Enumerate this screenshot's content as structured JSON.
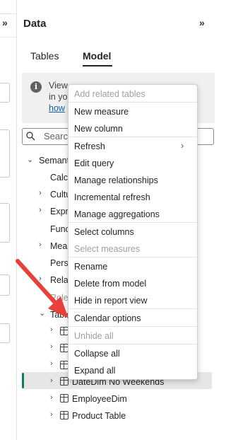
{
  "pane": {
    "title": "Data",
    "collapse_glyph": "»",
    "left_expand_glyph": "»",
    "tabs": [
      {
        "label": "Tables",
        "active": false
      },
      {
        "label": "Model",
        "active": true
      }
    ]
  },
  "info": {
    "line1": "View",
    "line2": "in yo",
    "link": "how"
  },
  "search": {
    "placeholder": "Searc"
  },
  "tree": {
    "semantic_model": "Semant",
    "items": [
      {
        "label": "Calcu",
        "chevron": false
      },
      {
        "label": "Cultu",
        "chevron": true
      },
      {
        "label": "Expre",
        "chevron": true
      },
      {
        "label": "Func",
        "chevron": false
      },
      {
        "label": "Meas",
        "chevron": true
      },
      {
        "label": "Persp",
        "chevron": false
      },
      {
        "label": "Relat",
        "chevron": true
      },
      {
        "label": "Role",
        "chevron": false
      }
    ],
    "tables_label": "Table",
    "tables": [
      {
        "label": ""
      },
      {
        "label": ""
      },
      {
        "label": ""
      },
      {
        "label": "DateDim No Weekends",
        "selected": true
      },
      {
        "label": "EmployeeDim"
      },
      {
        "label": "Product Table"
      }
    ]
  },
  "context_menu": {
    "items": [
      {
        "label": "Add related tables",
        "disabled": true
      },
      {
        "label": "New measure",
        "disabled": false
      },
      {
        "label": "New column",
        "disabled": false
      },
      {
        "label": "Refresh",
        "disabled": false,
        "submenu": true
      },
      {
        "label": "Edit query",
        "disabled": false
      },
      {
        "label": "Manage relationships",
        "disabled": false
      },
      {
        "label": "Incremental refresh",
        "disabled": false
      },
      {
        "label": "Manage aggregations",
        "disabled": false
      },
      {
        "label": "Select columns",
        "disabled": false
      },
      {
        "label": "Select measures",
        "disabled": true
      },
      {
        "label": "Rename",
        "disabled": false
      },
      {
        "label": "Delete from model",
        "disabled": false
      },
      {
        "label": "Hide in report view",
        "disabled": false
      },
      {
        "label": "Calendar options",
        "disabled": false
      },
      {
        "label": "Unhide all",
        "disabled": true
      },
      {
        "label": "Collapse all",
        "disabled": false
      },
      {
        "label": "Expand all",
        "disabled": false
      }
    ],
    "submenu_glyph": "›"
  },
  "colors": {
    "accent_selected": "#0f7b62",
    "annotation_arrow": "#e8413c",
    "link": "#115ea3"
  }
}
